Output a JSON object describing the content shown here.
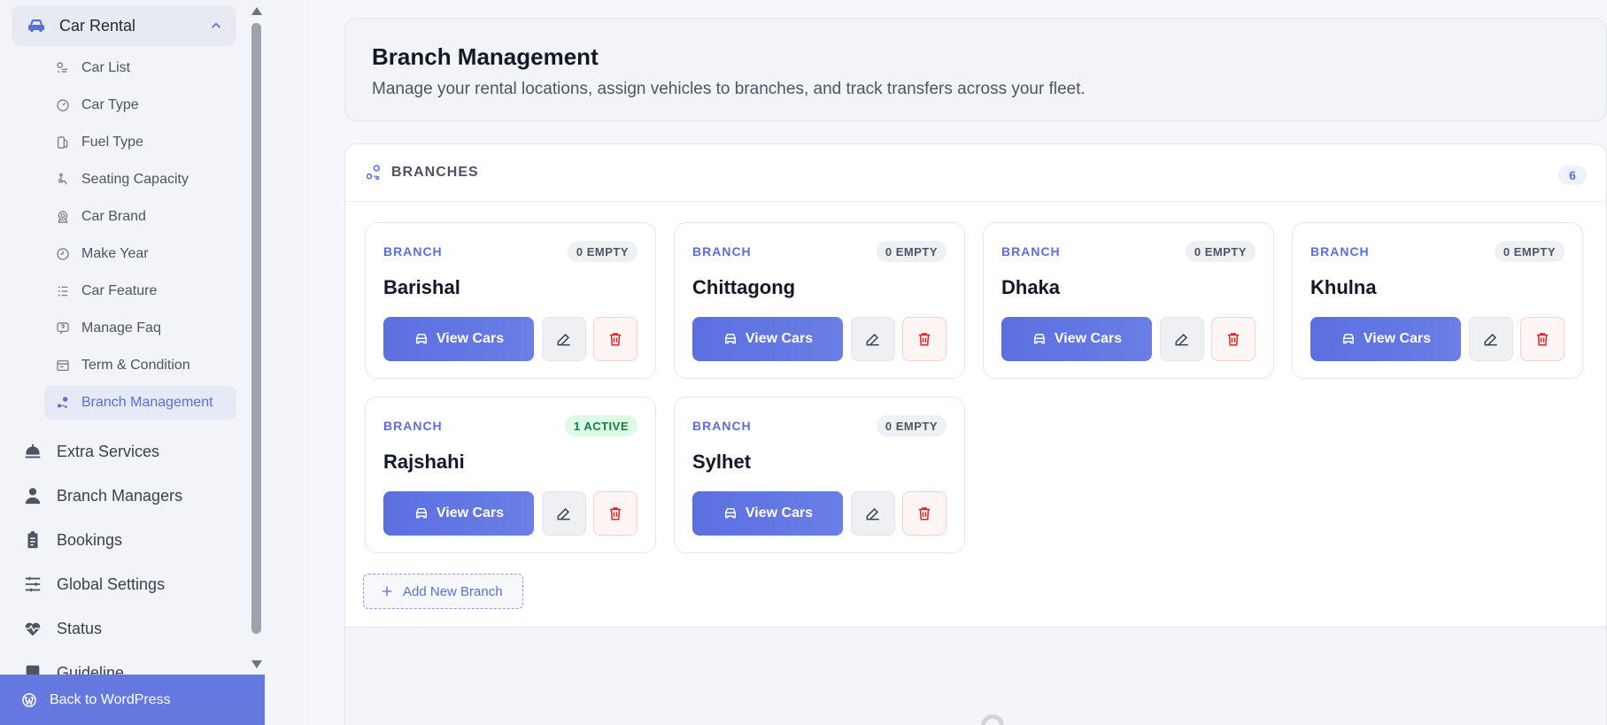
{
  "sidebar": {
    "parent": {
      "label": "Car Rental",
      "icon": "car-icon"
    },
    "sub_items": [
      {
        "label": "Car List",
        "icon": "car-list-icon"
      },
      {
        "label": "Car Type",
        "icon": "gauge-icon"
      },
      {
        "label": "Fuel Type",
        "icon": "fuel-icon"
      },
      {
        "label": "Seating Capacity",
        "icon": "seat-icon"
      },
      {
        "label": "Car Brand",
        "icon": "brand-icon"
      },
      {
        "label": "Make Year",
        "icon": "clock-icon"
      },
      {
        "label": "Car Feature",
        "icon": "list-icon"
      },
      {
        "label": "Manage Faq",
        "icon": "faq-icon"
      },
      {
        "label": "Term & Condition",
        "icon": "document-icon"
      },
      {
        "label": "Branch Management",
        "icon": "branch-icon",
        "active": true
      }
    ],
    "main_items": [
      {
        "label": "Extra Services",
        "icon": "service-bell-icon"
      },
      {
        "label": "Branch Managers",
        "icon": "user-tie-icon"
      },
      {
        "label": "Bookings",
        "icon": "clipboard-icon"
      },
      {
        "label": "Global Settings",
        "icon": "sliders-icon"
      },
      {
        "label": "Status",
        "icon": "heart-pulse-icon"
      },
      {
        "label": "Guideline",
        "icon": "book-icon"
      }
    ],
    "back_label": "Back to WordPress"
  },
  "header": {
    "title": "Branch Management",
    "subtitle": "Manage your rental locations, assign vehicles to branches, and track transfers across your fleet."
  },
  "branches": {
    "heading": "BRANCHES",
    "count": "6",
    "tag_label": "BRANCH",
    "view_label": "View Cars",
    "add_label": "Add New Branch",
    "items": [
      {
        "name": "Barishal",
        "status": "0 EMPTY",
        "active": false
      },
      {
        "name": "Chittagong",
        "status": "0 EMPTY",
        "active": false
      },
      {
        "name": "Dhaka",
        "status": "0 EMPTY",
        "active": false
      },
      {
        "name": "Khulna",
        "status": "0 EMPTY",
        "active": false
      },
      {
        "name": "Rajshahi",
        "status": "1 ACTIVE",
        "active": true
      },
      {
        "name": "Sylhet",
        "status": "0 EMPTY",
        "active": false
      }
    ]
  },
  "colors": {
    "accent": "#5b6fd8",
    "delete": "#dc2626",
    "active_badge": "#15803d"
  }
}
